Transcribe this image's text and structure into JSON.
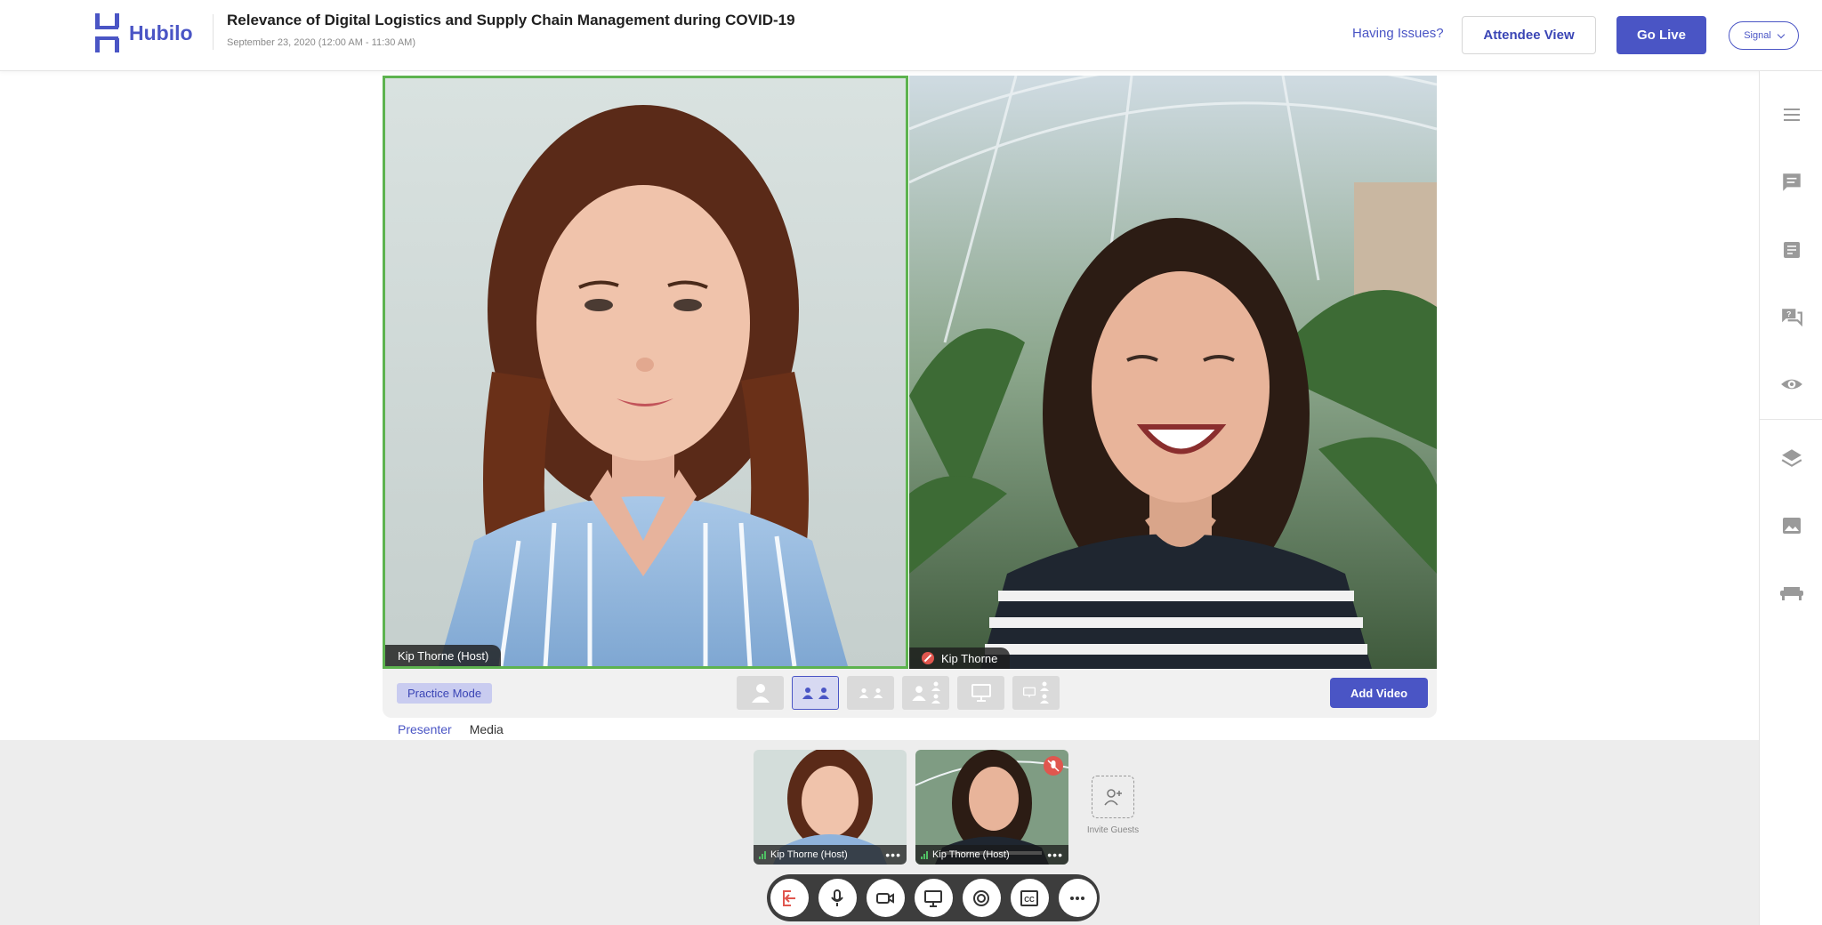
{
  "header": {
    "logo_text": "Hubilo",
    "event_title": "Relevance of Digital Logistics and Supply Chain Management during COVID-19",
    "event_date": "September 23, 2020 (12:00 AM - 11:30 AM)",
    "having_issues": "Having Issues?",
    "attendee_view": "Attendee View",
    "go_live": "Go Live",
    "signal": "Signal"
  },
  "stage": {
    "tiles": [
      {
        "name": "Kip Thorne (Host)",
        "muted": false,
        "active_speaker": true
      },
      {
        "name": "Kip Thorne",
        "muted": true,
        "active_speaker": false
      }
    ],
    "practice_mode": "Practice Mode",
    "add_video": "Add Video"
  },
  "tabs": [
    {
      "label": "Presenter",
      "active": true
    },
    {
      "label": "Media",
      "active": false
    }
  ],
  "participants": [
    {
      "name": "Kip Thorne (Host)",
      "muted": false
    },
    {
      "name": "Kip Thorne (Host)",
      "muted": true
    }
  ],
  "invite_guests": "Invite Guests",
  "controls": [
    "leave-icon",
    "microphone-icon",
    "camera-icon",
    "screen-share-icon",
    "record-icon",
    "closed-captions-icon",
    "more-icon"
  ],
  "right_sidebar": [
    "menu-icon",
    "chat-icon",
    "notes-icon",
    "qna-icon",
    "views-icon",
    "layers-icon",
    "image-icon",
    "lounge-icon"
  ],
  "colors": {
    "brand": "#4a55c5",
    "active_speaker": "#5db34f",
    "muted": "#e0564e"
  }
}
